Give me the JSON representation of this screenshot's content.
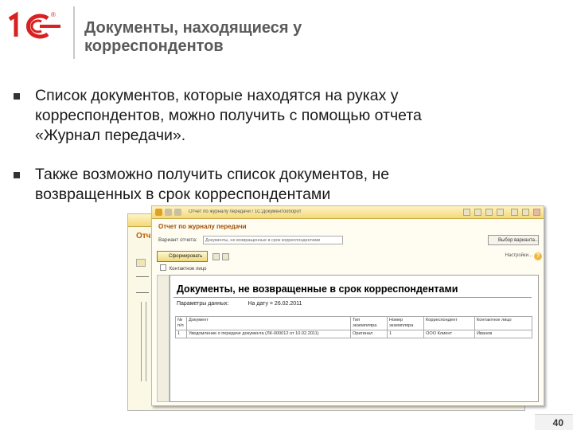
{
  "brand": {
    "logo_label": "1С",
    "logo_mark": "®",
    "accent_color": "#d82121"
  },
  "slide": {
    "title": "Документы, находящиеся у корреспондентов",
    "bullets": [
      "Список документов, которые находятся на руках у корреспондентов, можно получить с помощью отчета «Журнал передачи».",
      "Также возможно получить список документов, не возвращенных в срок корреспондентами"
    ],
    "page_number": "40"
  },
  "window": {
    "title_text": "Отчет по журналу передачи / 1С:Документооборот",
    "back_title": "Отч",
    "report_title": "Отчет по журналу передачи",
    "variant_label": "Вариант отчета:",
    "variant_value": "Документы, не возвращенные в срок корреспондентами",
    "variant_button": "Выбор варианта...",
    "form_button": "Сформировать",
    "settings_label": "Настройки...",
    "help_icon_text": "?",
    "checkbox_label": "Контактное лицо",
    "report": {
      "title": "Документы, не возвращенные в срок корреспондентами",
      "params_label": "Параметры данных:",
      "params_value": "На дату = 26.02.2011",
      "columns": [
        "№ п/п",
        "Документ",
        "Тип экземпляра",
        "Номер экземпляра",
        "Корреспондент",
        "Контактное лицо"
      ],
      "rows": [
        [
          "1",
          "Уведомление о передаче документа (ЛК-000012 от 10.02.2011)",
          "Оригинал",
          "1",
          "ООО Клиент",
          "Иванов"
        ]
      ]
    }
  }
}
